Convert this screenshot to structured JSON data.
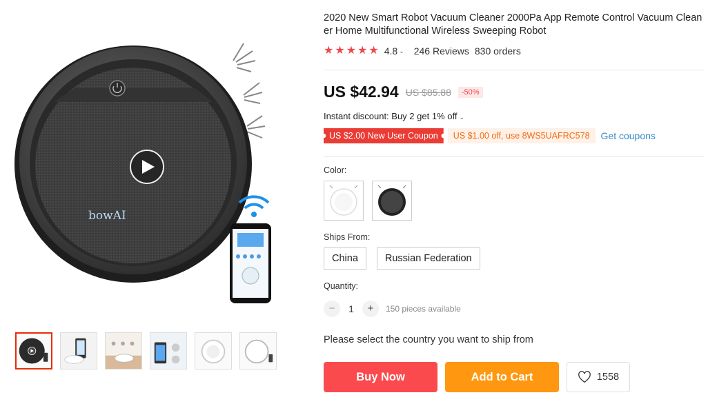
{
  "product": {
    "title": "2020 New Smart Robot Vacuum Cleaner 2000Pa App Remote Control Vacuum Clean er Home Multifunctional Wireless Sweeping Robot",
    "rating": "4.8",
    "reviews": "246 Reviews",
    "orders": "830 orders",
    "star_count": 5,
    "brand_logo": "bowAI"
  },
  "price": {
    "current": "US $42.94",
    "original": "US $85.88",
    "discount": "-50%"
  },
  "promo": {
    "instant_discount": "Instant discount: Buy 2 get 1% off",
    "new_user_coupon": "US $2.00 New User Coupon",
    "store_coupon": "US $1.00 off, use 8WS5UAFRC578",
    "get_coupons": "Get coupons"
  },
  "options": {
    "color_label": "Color:",
    "colors": [
      "white",
      "black"
    ],
    "ships_from_label": "Ships From:",
    "ships_from": [
      "China",
      "Russian Federation"
    ],
    "quantity_label": "Quantity:",
    "quantity": "1",
    "minus": "−",
    "plus": "+",
    "available": "150 pieces available"
  },
  "shipping_note": "Please select the country you want to ship from",
  "actions": {
    "buy_now": "Buy Now",
    "add_to_cart": "Add to Cart",
    "wishlist_count": "1558"
  },
  "colors": {
    "accent_red": "#fa4a4d",
    "cart_orange": "#ff9810",
    "link_blue": "#3a8ac8"
  }
}
